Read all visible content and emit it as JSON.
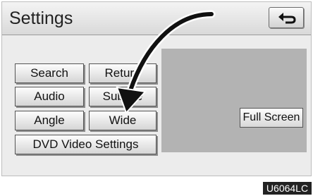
{
  "header": {
    "title": "Settings",
    "back_icon": "return-arrow-icon"
  },
  "buttons": {
    "search": "Search",
    "return": "Return",
    "audio": "Audio",
    "subtitle": "Subtitle",
    "angle": "Angle",
    "wide": "Wide",
    "dvd_video_settings": "DVD Video Settings",
    "full_screen": "Full Screen"
  },
  "figure_code": "U6064LC"
}
